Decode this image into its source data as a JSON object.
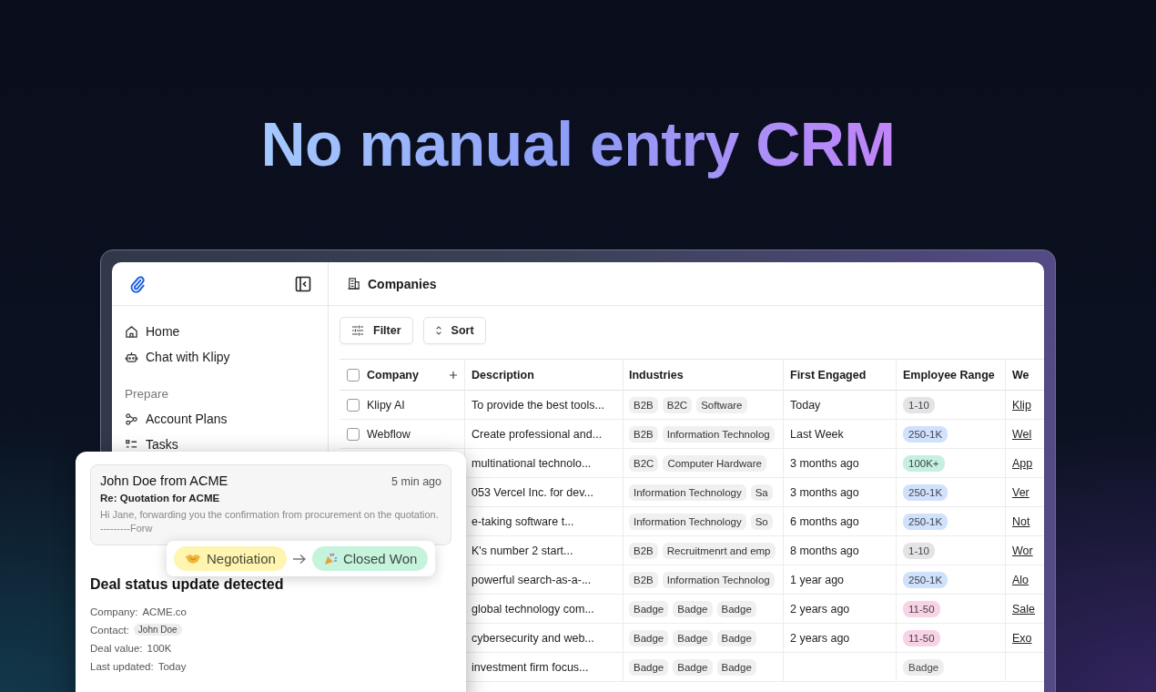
{
  "headline": "No manual entry CRM",
  "sidebar": {
    "items": [
      {
        "label": "Home"
      },
      {
        "label": "Chat with Klipy"
      }
    ],
    "sections": [
      {
        "title": "Prepare",
        "items": [
          {
            "label": "Account Plans"
          },
          {
            "label": "Tasks"
          }
        ]
      }
    ]
  },
  "page_title": "Companies",
  "toolbar": [
    "Filter",
    "Sort"
  ],
  "table": {
    "select_all": {
      "checked": false
    },
    "columns": [
      "Company",
      "Description",
      "Industries",
      "First Engaged",
      "Employee Range",
      "We"
    ],
    "rows": [
      {
        "checked": false,
        "company": "Klipy AI",
        "description": "To provide the best tools...",
        "industries": [
          "B2B",
          "B2C",
          "Software"
        ],
        "first_engaged": "Today",
        "employee_range": {
          "label": "1-10",
          "color": "#e4e4e7"
        },
        "website": "Klip"
      },
      {
        "checked": false,
        "company": "Webflow",
        "description": "Create professional and...",
        "industries": [
          "B2B",
          "Information Technolog"
        ],
        "first_engaged": "Last Week",
        "employee_range": {
          "label": "250-1K",
          "color": "#cfe1fb"
        },
        "website": "Wel"
      },
      {
        "description": "multinational technolo...",
        "industries": [
          "B2C",
          "Computer Hardware"
        ],
        "first_engaged": "3 months ago",
        "employee_range": {
          "label": "100K+",
          "color": "#c6efe3"
        },
        "website": "App"
      },
      {
        "description": "053 Vercel Inc. for dev...",
        "industries": [
          "Information Technology",
          "Sa"
        ],
        "first_engaged": "3 months ago",
        "employee_range": {
          "label": "250-1K",
          "color": "#cfe1fb"
        },
        "website": "Ver"
      },
      {
        "description": "e-taking software t...",
        "industries": [
          "Information Technology",
          "So"
        ],
        "first_engaged": "6 months ago",
        "employee_range": {
          "label": "250-1K",
          "color": "#cfe1fb"
        },
        "website": "Not"
      },
      {
        "description": "K's number 2 start...",
        "industries": [
          "B2B",
          "Recruitmenrt and emp"
        ],
        "first_engaged": "8 months ago",
        "employee_range": {
          "label": "1-10",
          "color": "#e4e4e7"
        },
        "website": "Wor"
      },
      {
        "description": "powerful search-as-a-...",
        "industries": [
          "B2B",
          "Information Technolog"
        ],
        "first_engaged": "1 year ago",
        "employee_range": {
          "label": "250-1K",
          "color": "#cfe1fb"
        },
        "website": "Alo"
      },
      {
        "description": "global technology com...",
        "industries": [
          "Badge",
          "Badge",
          "Badge"
        ],
        "first_engaged": "2 years ago",
        "employee_range": {
          "label": "11-50",
          "color": "#f8d3e6"
        },
        "website": "Sale"
      },
      {
        "description": "cybersecurity and web...",
        "industries": [
          "Badge",
          "Badge",
          "Badge"
        ],
        "first_engaged": "2 years ago",
        "employee_range": {
          "label": "11-50",
          "color": "#f8d3e6"
        },
        "website": "Exo"
      },
      {
        "description": "investment firm focus...",
        "industries": [
          "Badge",
          "Badge",
          "Badge"
        ],
        "employee_range": {
          "label": "Badge",
          "color": "#ededed"
        }
      }
    ]
  },
  "deal_card": {
    "email": {
      "sender": "John Doe from ACME",
      "time": "5 min ago",
      "subject": "Re: Quotation for ACME",
      "preview": "Hi Jane, forwarding you the confirmation from procurement on the quotation. ---------Forw"
    },
    "stage_change": [
      {
        "label": "Negotiation",
        "color": "#fdf5b0"
      },
      {
        "label": "Closed Won",
        "color": "#c5f3dc"
      }
    ],
    "heading": "Deal status update detected",
    "fields": [
      {
        "label": "Company:",
        "value": "ACME.co",
        "kind": "text"
      },
      {
        "label": "Contact:",
        "value": "John Doe",
        "kind": "chip"
      },
      {
        "label": "Deal value:",
        "value": "100K",
        "kind": "text"
      },
      {
        "label": "Last updated:",
        "value": "Today",
        "kind": "text"
      }
    ]
  }
}
